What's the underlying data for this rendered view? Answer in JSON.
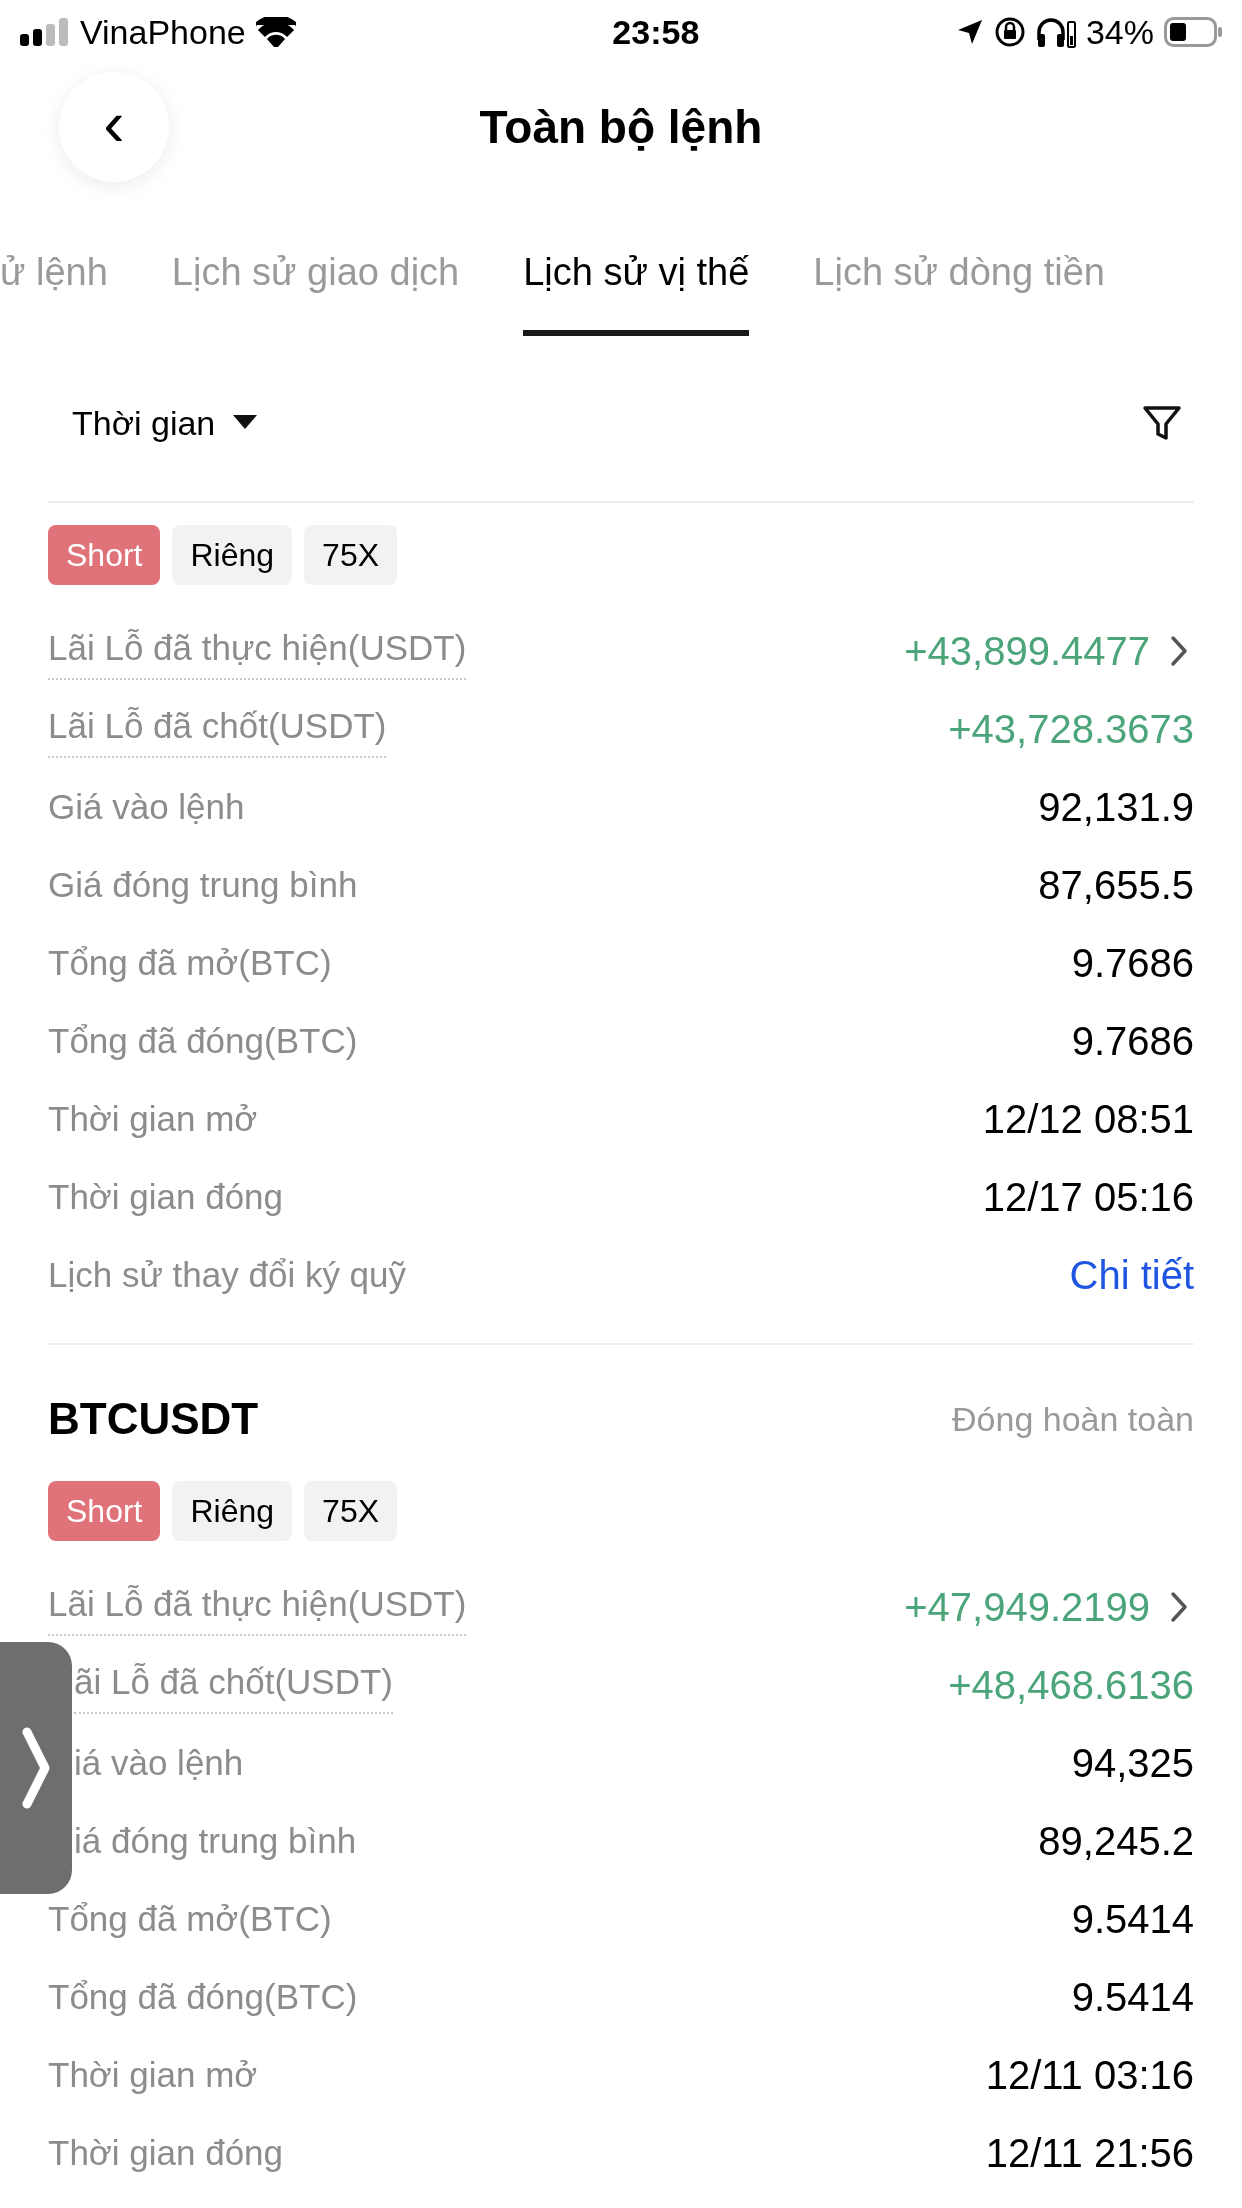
{
  "status_bar": {
    "carrier": "VinaPhone",
    "time": "23:58",
    "battery": "34%"
  },
  "header": {
    "back": "‹",
    "title": "Toàn bộ lệnh"
  },
  "tabs": [
    {
      "label": "ử lệnh",
      "selected": false
    },
    {
      "label": "Lịch sử giao dịch",
      "selected": false
    },
    {
      "label": "Lịch sử vị thế",
      "selected": true
    },
    {
      "label": "Lịch sử dòng tiền",
      "selected": false
    }
  ],
  "filter": {
    "label": "Thời gian"
  },
  "positions": [
    {
      "tags": [
        {
          "label": "Short",
          "kind": "side"
        },
        {
          "label": "Riêng",
          "kind": "plain"
        },
        {
          "label": "75X",
          "kind": "plain"
        }
      ],
      "rows": [
        {
          "label": "Lãi Lỗ đã thực hiện(USDT)",
          "value": "+43,899.4477",
          "kind": "pnl",
          "chevron": true
        },
        {
          "label": "Lãi Lỗ đã chốt(USDT)",
          "value": "+43,728.3673",
          "kind": "pnl"
        },
        {
          "label": "Giá vào lệnh",
          "value": "92,131.9",
          "kind": "plain"
        },
        {
          "label": "Giá đóng trung bình",
          "value": "87,655.5",
          "kind": "plain"
        },
        {
          "label": "Tổng đã mở(BTC)",
          "value": "9.7686",
          "kind": "plain"
        },
        {
          "label": "Tổng đã đóng(BTC)",
          "value": "9.7686",
          "kind": "plain"
        },
        {
          "label": "Thời gian mở",
          "value": "12/12 08:51",
          "kind": "plain"
        },
        {
          "label": "Thời gian đóng",
          "value": "12/17 05:16",
          "kind": "plain"
        },
        {
          "label": "Lịch sử thay đổi ký quỹ",
          "value": "Chi tiết",
          "kind": "link"
        }
      ]
    },
    {
      "symbol": "BTCUSDT",
      "status": "Đóng hoàn toàn",
      "tags": [
        {
          "label": "Short",
          "kind": "side"
        },
        {
          "label": "Riêng",
          "kind": "plain"
        },
        {
          "label": "75X",
          "kind": "plain"
        }
      ],
      "rows": [
        {
          "label": "Lãi Lỗ đã thực hiện(USDT)",
          "value": "+47,949.2199",
          "kind": "pnl",
          "chevron": true
        },
        {
          "label": "ãi Lỗ đã chốt(USDT)",
          "value": "+48,468.6136",
          "kind": "pnl",
          "clipped": true
        },
        {
          "label": "iá vào lệnh",
          "value": "94,325",
          "kind": "plain",
          "clipped": true
        },
        {
          "label": "iá đóng trung bình",
          "value": "89,245.2",
          "kind": "plain",
          "clipped": true
        },
        {
          "label": "Tổng đã mở(BTC)",
          "value": "9.5414",
          "kind": "plain"
        },
        {
          "label": "Tổng đã đóng(BTC)",
          "value": "9.5414",
          "kind": "plain"
        },
        {
          "label": "Thời gian mở",
          "value": "12/11 03:16",
          "kind": "plain"
        },
        {
          "label": "Thời gian đóng",
          "value": "12/11 21:56",
          "kind": "plain"
        }
      ]
    }
  ]
}
